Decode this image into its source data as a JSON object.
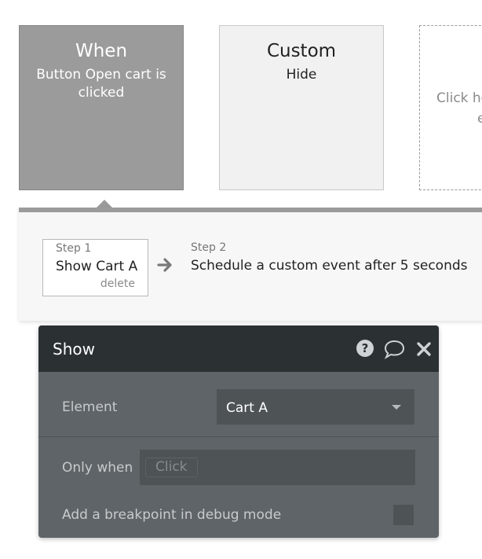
{
  "events": {
    "when": {
      "title": "When",
      "subtitle": "Button Open cart is clicked"
    },
    "custom": {
      "title": "Custom",
      "subtitle": "Hide"
    },
    "add_event": {
      "hint_line1": "Click he",
      "hint_line2": "e"
    }
  },
  "steps": [
    {
      "label": "Step 1",
      "name": "Show Cart A",
      "delete_label": "delete"
    },
    {
      "label": "Step 2",
      "name": "Schedule a custom event after 5 seconds"
    }
  ],
  "dialog": {
    "title": "Show",
    "header_icons": [
      "help-icon",
      "comment-icon",
      "close-icon"
    ],
    "element": {
      "label": "Element",
      "value": "Cart A"
    },
    "only_when": {
      "label": "Only when",
      "placeholder": "Click"
    },
    "breakpoint": {
      "label": "Add a breakpoint in debug mode",
      "checked": false
    }
  },
  "colors": {
    "active_event": "#9b9b9b",
    "dialog_header": "#2b3033",
    "dialog_body": "#5f6468",
    "field": "#4e5356"
  }
}
